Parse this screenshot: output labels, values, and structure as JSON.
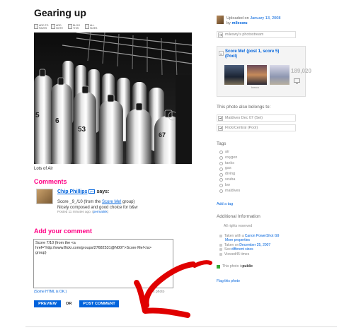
{
  "title": "Gearing up",
  "toolbar": [
    {
      "icon": "fave-star-icon",
      "label": "ADD TO FAVES"
    },
    {
      "icon": "note-icon",
      "label": "ADD NOTE"
    },
    {
      "icon": "blog-icon",
      "label": "BLOG THIS"
    },
    {
      "icon": "sizes-icon",
      "label": "ALL SIZES"
    }
  ],
  "caption": "Lots of Air",
  "comments": {
    "heading": "Comments",
    "items": [
      {
        "author": "Chip Phillips",
        "pro_badge": "pro",
        "says": "says:",
        "line1_prefix": "Score _9_/10 (from the ",
        "line1_link": "Score Me!",
        "line1_suffix": " group)",
        "line2": "Nicely composed and good choice for b&w",
        "meta_prefix": "Posted 11 minutes ago. (",
        "meta_link": "permalink",
        "meta_suffix": ")"
      }
    ]
  },
  "add_comment": {
    "heading": "Add your comment",
    "textarea_value": "Score 7/10 (from the <a\nhref=\"http://www.flickr.com/groups/27682531@N00/\">Score Me!</a>\ngroup)",
    "html_ok": "(Some HTML is OK.)",
    "html_ok_tail": "s photo",
    "preview_label": "PREVIEW",
    "or_label": "OR",
    "post_label": "POST COMMENT"
  },
  "sidebar": {
    "uploaded_prefix": "Uploaded on ",
    "uploaded_date": "January 13, 2008",
    "by_prefix": "by ",
    "owner": "mileswu",
    "photostream": "mileswy's photostream",
    "pool": {
      "title": "Score Me! (post 1, score 5)",
      "subtitle": "(Pool)",
      "thumb_labels": [
        "",
        "bresca",
        ""
      ],
      "count": "189,020"
    },
    "belongs_heading": "This photo also belongs to:",
    "sets": [
      "Maldives Dec 07 (Set)",
      "FlickrCentral (Pool)"
    ],
    "tags_heading": "Tags",
    "tags": [
      "air",
      "oxygen",
      "tanks",
      "gas",
      "diving",
      "scuba",
      "bw",
      "maldives"
    ],
    "add_tag": "Add a tag",
    "additional_heading": "Additional Information",
    "rights": "All rights reserved",
    "info": [
      {
        "pre": "Taken with a ",
        "link": "Canon PowerShot G9",
        "post": ""
      },
      {
        "pre": "",
        "link": "More properties",
        "post": ""
      },
      {
        "pre": "Taken on ",
        "link": "December 25, 2007",
        "post": ""
      },
      {
        "pre": "See ",
        "link": "different sizes",
        "post": ""
      },
      {
        "pre": "Viewed ",
        "link": "",
        "post": "45 times"
      }
    ],
    "public_pre": "This photo is ",
    "public_value": "public",
    "flag": "Flag this photo"
  },
  "colors": {
    "accent_pink": "#ff0084",
    "link_blue": "#0063dc",
    "annotation_red": "#e00000"
  }
}
